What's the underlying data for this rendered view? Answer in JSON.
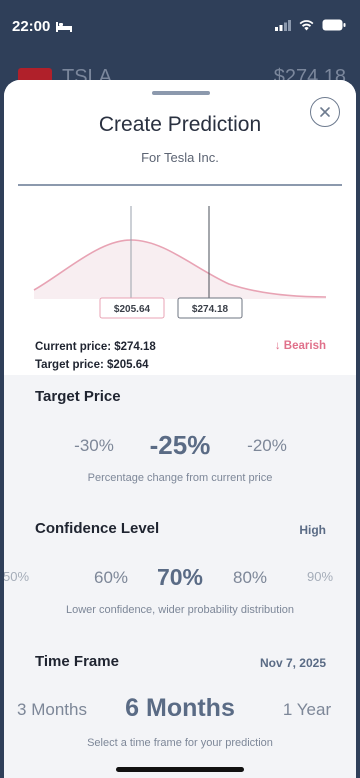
{
  "status_bar": {
    "time": "22:00"
  },
  "background": {
    "ticker": "TSLA",
    "price": "$274.18"
  },
  "sheet": {
    "title": "Create Prediction",
    "subtitle": "For Tesla Inc.",
    "close_icon": "close-icon",
    "chart": {
      "target_label": "$205.64",
      "current_label": "$274.18",
      "curve_color": "#e8a3b4"
    },
    "current_price": "Current price: $274.18",
    "target_price": "Target price: $205.64",
    "sentiment": "↓ Bearish",
    "target_section": {
      "title": "Target Price",
      "options": [
        "-30%",
        "-25%",
        "-20%"
      ],
      "caption": "Percentage change from current price"
    },
    "confidence_section": {
      "title": "Confidence Level",
      "level": "High",
      "options": [
        "50%",
        "60%",
        "70%",
        "80%",
        "90%"
      ],
      "caption": "Lower confidence, wider probability distribution"
    },
    "timeframe_section": {
      "title": "Time Frame",
      "date": "Nov 7, 2025",
      "options": [
        "3 Months",
        "6 Months",
        "1 Year"
      ],
      "caption": "Select a time frame for your prediction"
    }
  }
}
